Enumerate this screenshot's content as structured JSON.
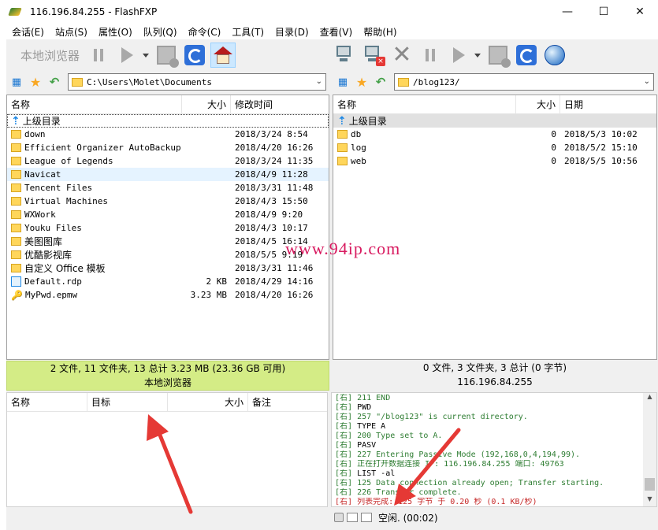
{
  "window": {
    "title": "116.196.84.255 - FlashFXP"
  },
  "menu": [
    "会话(E)",
    "站点(S)",
    "属性(O)",
    "队列(Q)",
    "命令(C)",
    "工具(T)",
    "目录(D)",
    "查看(V)",
    "帮助(H)"
  ],
  "toolbar_left": {
    "label": "本地浏览器"
  },
  "local": {
    "path": "C:\\Users\\Molet\\Documents",
    "columns": {
      "name": "名称",
      "size": "大小",
      "modified": "修改时间"
    },
    "parent_label": "上级目录",
    "files": [
      {
        "name": "down",
        "size": "",
        "date": "2018/3/24 8:54",
        "type": "folder"
      },
      {
        "name": "Efficient Organizer AutoBackup",
        "size": "",
        "date": "2018/4/20 16:26",
        "type": "folder"
      },
      {
        "name": "League of Legends",
        "size": "",
        "date": "2018/3/24 11:35",
        "type": "folder"
      },
      {
        "name": "Navicat",
        "size": "",
        "date": "2018/4/9 11:28",
        "type": "folder"
      },
      {
        "name": "Tencent Files",
        "size": "",
        "date": "2018/3/31 11:48",
        "type": "folder"
      },
      {
        "name": "Virtual Machines",
        "size": "",
        "date": "2018/4/3 15:50",
        "type": "folder"
      },
      {
        "name": "WXWork",
        "size": "",
        "date": "2018/4/9 9:20",
        "type": "folder"
      },
      {
        "name": "Youku Files",
        "size": "",
        "date": "2018/4/3 10:17",
        "type": "folder"
      },
      {
        "name": "美图图库",
        "size": "",
        "date": "2018/4/5 16:14",
        "type": "folder"
      },
      {
        "name": "优酷影视库",
        "size": "",
        "date": "2018/5/5 9:19",
        "type": "folder"
      },
      {
        "name": "自定义 Office 模板",
        "size": "",
        "date": "2018/3/31 11:46",
        "type": "folder"
      },
      {
        "name": "Default.rdp",
        "size": "2 KB",
        "date": "2018/4/29 14:16",
        "type": "file"
      },
      {
        "name": "MyPwd.epmw",
        "size": "3.23 MB",
        "date": "2018/4/20 16:26",
        "type": "key"
      }
    ],
    "status_line1": "2 文件, 11 文件夹, 13 总计 3.23 MB (23.36 GB 可用)",
    "status_line2": "本地浏览器"
  },
  "remote": {
    "path": "/blog123/",
    "columns": {
      "name": "名称",
      "size": "大小",
      "date": "日期"
    },
    "parent_label": "上级目录",
    "files": [
      {
        "name": "db",
        "size": "0",
        "date": "2018/5/3 10:02"
      },
      {
        "name": "log",
        "size": "0",
        "date": "2018/5/2 15:10"
      },
      {
        "name": "web",
        "size": "0",
        "date": "2018/5/5 10:56"
      }
    ],
    "status_line1": "0 文件, 3 文件夹, 3 总计 (0 字节)",
    "status_line2": "116.196.84.255"
  },
  "queue": {
    "columns": {
      "name": "名称",
      "target": "目标",
      "size": "大小",
      "note": "备注"
    }
  },
  "log": [
    {
      "tag": "[右]",
      "text": "211 END",
      "kind": "resp"
    },
    {
      "tag": "[右]",
      "text": "PWD",
      "kind": "cmd"
    },
    {
      "tag": "[右]",
      "text": "257 \"/blog123\" is current directory.",
      "kind": "resp"
    },
    {
      "tag": "[右]",
      "text": "TYPE A",
      "kind": "cmd"
    },
    {
      "tag": "[右]",
      "text": "200 Type set to A.",
      "kind": "resp"
    },
    {
      "tag": "[右]",
      "text": "PASV",
      "kind": "cmd"
    },
    {
      "tag": "[右]",
      "text": "227 Entering Passive Mode (192,168,0,4,194,99).",
      "kind": "resp"
    },
    {
      "tag": "[右]",
      "text": "正在打开数据连接 IP: 116.196.84.255 端口: 49763",
      "kind": "resp"
    },
    {
      "tag": "[右]",
      "text": "LIST -al",
      "kind": "cmd"
    },
    {
      "tag": "[右]",
      "text": "125 Data connection already open; Transfer starting.",
      "kind": "resp"
    },
    {
      "tag": "[右]",
      "text": "226 Transfer complete.",
      "kind": "resp"
    },
    {
      "tag": "[右]",
      "text": "列表完成: 125 字节 于 0.20 秒 (0.1 KB/秒)",
      "kind": "final"
    }
  ],
  "bottom_status": "空闲. (00:02)",
  "watermark": "www.94ip.com"
}
